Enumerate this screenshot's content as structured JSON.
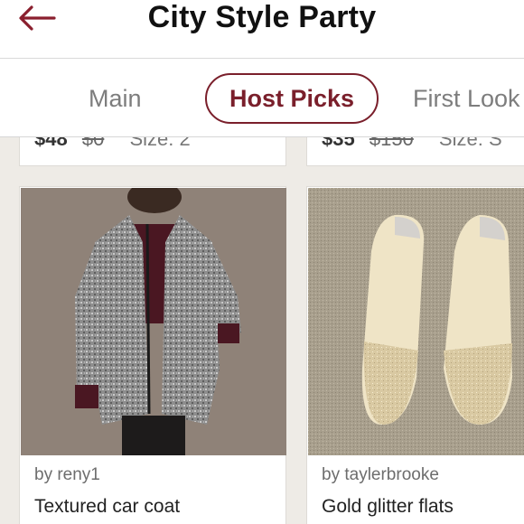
{
  "header": {
    "title": "City Style Party",
    "back_icon": "back-arrow-icon",
    "accent": "#8a1f2e"
  },
  "tabs": [
    {
      "label": "Main",
      "selected": false
    },
    {
      "label": "Host Picks",
      "selected": true
    },
    {
      "label": "First Look",
      "selected": false
    }
  ],
  "top_row": [
    {
      "price": "$48",
      "original_price": "$0",
      "size": "Size: 2"
    },
    {
      "price": "$35",
      "original_price": "$150",
      "size": "Size: S"
    }
  ],
  "listings": [
    {
      "byline": "by reny1",
      "title": "Textured car coat",
      "image_icon": "coat-photo"
    },
    {
      "byline": "by taylerbrooke",
      "title": "Gold glitter flats",
      "image_icon": "flats-photo"
    }
  ]
}
